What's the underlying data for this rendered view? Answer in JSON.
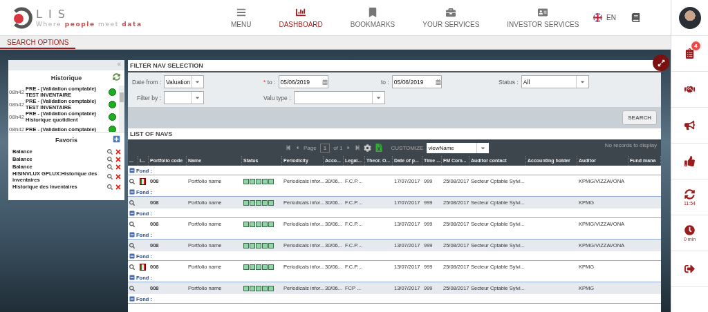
{
  "logo": {
    "mark": "LIS",
    "tagline": "Where **people** meet **data**"
  },
  "nav": [
    {
      "label": "MENU",
      "selected": false
    },
    {
      "label": "DASHBOARD",
      "selected": true
    },
    {
      "label": "BOOKMARKS",
      "selected": false
    },
    {
      "label": "YOUR SERVICES",
      "selected": false
    },
    {
      "label": "INVESTOR SERVICES",
      "selected": false
    }
  ],
  "language": "EN",
  "subtabs": [
    {
      "label": "SEARCH OPTIONS",
      "selected": true
    }
  ],
  "side_panel": {
    "collapse": "«",
    "history": {
      "title": "Historique",
      "items": [
        {
          "time": "08h42",
          "title": "PRE - (Validation comptable)",
          "detail": "TEST INVENTAIRE"
        },
        {
          "time": "08h42",
          "title": "PRE - (Validation comptable)",
          "detail": "TEST INVENTAIRE"
        },
        {
          "time": "08h42",
          "title": "PRE - (Validation comptable)",
          "detail": "Historique quotidient"
        },
        {
          "time": "08h42",
          "title": "PRE - (Validation comptable)"
        }
      ]
    },
    "favorites": {
      "title": "Favoris",
      "items": [
        "Balance",
        "Balance",
        "Balance",
        "HISINVLUX GPLUX:Historique des inventaires",
        "Historique des inventaires"
      ]
    }
  },
  "filter": {
    "title": "FILTER NAV SELECTION",
    "fields": [
      {
        "kind": "select",
        "label": "Date from :",
        "value": "Valuation",
        "required": false
      },
      {
        "kind": "date",
        "label": "to :",
        "value": "05/06/2019",
        "required": true
      },
      {
        "kind": "date",
        "label": "to :",
        "value": "05/06/2019",
        "required": false
      },
      {
        "kind": "select",
        "label": "Status :",
        "value": "All",
        "required": false
      },
      {
        "kind": "select",
        "label": "Filter by :",
        "required": false
      },
      {
        "kind": "select",
        "label": "Valu type :",
        "required": false
      }
    ],
    "required_mark": "*",
    "button": "SEARCH"
  },
  "list": {
    "title": "LIST OF NAVS",
    "pager": {
      "page_label": "Page",
      "page": "1",
      "of": "of 1"
    },
    "customize": "CUSTOMIZE",
    "view": "viewName",
    "empty": "No records to display",
    "columns": [
      "...",
      "i...",
      "Portfolio code",
      "Name",
      "Status",
      "Periodicity",
      "Acco...",
      "Legal...",
      "Theor. O...",
      "Date of p...",
      "Time ...",
      "FM Com...",
      "Auditor contact",
      "Accounting holder",
      "Auditor",
      "Fund mana"
    ],
    "rows": [
      {
        "group": "Fond :",
        "flag": true,
        "code": "008",
        "name": "Portfolio name",
        "periodicity": "Periodicals infor...",
        "acco": "30/06...",
        "legal": "F.C.P....",
        "date": "17/07/2017",
        "time": "999",
        "fm": "25/08/2017",
        "contact": "Secteur Cptable Sylvi...",
        "auditor": "KPMG/VIZZAVONA"
      },
      {
        "group": "Fond :",
        "flag": false,
        "code": "008",
        "name": "Portfolio name",
        "periodicity": "Periodicals infor...",
        "acco": "30/06...",
        "legal": "F.C.P....",
        "date": "17/07/2017",
        "time": "999",
        "fm": "25/08/2017",
        "contact": "Secteur Cptable Sylvi...",
        "auditor": "KPMG"
      },
      {
        "group": "Fond :",
        "flag": false,
        "code": "008",
        "name": "Portfolio name",
        "periodicity": "Periodicals infor...",
        "acco": "30/06...",
        "legal": "F.C.P....",
        "date": "13/07/2017",
        "time": "999",
        "fm": "25/08/2017",
        "contact": "Secteur Cptable Sylvi...",
        "auditor": "KPMG/VIZZAVONA"
      },
      {
        "group": "Fond :",
        "flag": false,
        "code": "008",
        "name": "Portfolio name",
        "periodicity": "Periodicals infor...",
        "acco": "30/06...",
        "legal": "F.C.P....",
        "date": "13/07/2017",
        "time": "999",
        "fm": "25/08/2017",
        "contact": "Secteur Cptable Sylvi...",
        "auditor": "KPMG/VIZZAVONA"
      },
      {
        "group": "Fond :",
        "flag": true,
        "code": "008",
        "name": "Portfolio name",
        "periodicity": "Periodicals infor...",
        "acco": "30/06...",
        "legal": "F.C.P....",
        "date": "13/07/2017",
        "time": "999",
        "fm": "25/08/2017",
        "contact": "Secteur Cptable Sylvi...",
        "auditor": "KPMG"
      },
      {
        "group": "Fond :",
        "flag": false,
        "code": "008",
        "name": "Portfolio name",
        "periodicity": "Periodicals infor...",
        "acco": "30/06...",
        "legal": "FCP ...",
        "date": "13/07/2017",
        "time": "999",
        "fm": "25/08/2017",
        "contact": "Secteur Cptable Sylvi...",
        "auditor": "KPMG"
      },
      {
        "group": "Fond :"
      }
    ]
  },
  "rail": {
    "badge": "4",
    "sync_time": "11:54",
    "timer": "0 min"
  }
}
